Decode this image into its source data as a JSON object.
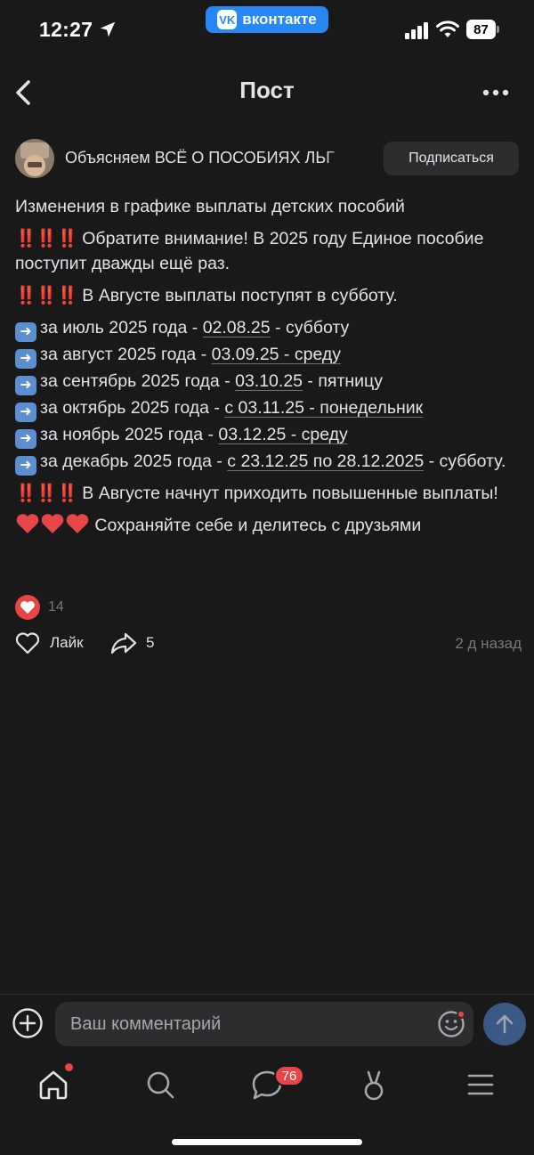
{
  "status_bar": {
    "time": "12:27",
    "app_pill": "вконтакте",
    "battery": "87"
  },
  "header": {
    "title": "Пост"
  },
  "author": {
    "name": "Объясняем ВСЁ О ПОСОБИЯХ ЛЬГ",
    "subscribe_label": "Подписаться"
  },
  "post": {
    "title_line": "Изменения в графике выплаты детских пособий",
    "bangs": "‼️‼️‼️",
    "notice": "Обратите внимание! В 2025 году Единое пособие поступит дважды ещё раз.",
    "august_saturday": "В Августе выплаты поступят в субботу.",
    "schedule": [
      {
        "text": "за июль 2025 года - ",
        "link": "02.08.25",
        "rest": " - субботу"
      },
      {
        "text": "за август 2025 года - ",
        "link": "03.09.25 - среду",
        "rest": ""
      },
      {
        "text": "за сентябрь 2025 года - ",
        "link": "03.10.25",
        "rest": " - пятницу"
      },
      {
        "text": "за октябрь 2025 года - ",
        "link": "с 03.11.25 - понедельник",
        "rest": ""
      },
      {
        "text": "за ноябрь 2025 года - ",
        "link": "03.12.25 - среду",
        "rest": ""
      },
      {
        "text": "за декабрь 2025 года - ",
        "link": "с 23.12.25 по 28.12.2025",
        "rest": " - субботу."
      }
    ],
    "increased": "В Августе начнут приходить повышенные выплаты!",
    "share_call": "Сохраняйте себе и делитесь с друзьями"
  },
  "reactions": {
    "count": "14"
  },
  "actions": {
    "like_label": "Лайк",
    "share_count": "5",
    "time_ago": "2 д назад"
  },
  "comment": {
    "placeholder": "Ваш комментарий"
  },
  "tabbar": {
    "messages_badge": "76"
  },
  "colors": {
    "background": "#19191a",
    "text": "#e1e3e6",
    "secondary": "#76787a",
    "accent": "#2787f5",
    "red": "#e64646"
  },
  "icons": [
    "location-arrow-icon",
    "cellular-signal-icon",
    "wifi-icon",
    "battery-icon",
    "back-chevron-icon",
    "more-dots-icon",
    "arrow-right-emoji-icon",
    "red-heart-emoji-icon",
    "heart-reaction-icon",
    "like-heart-icon",
    "share-arrow-icon",
    "plus-circle-icon",
    "smile-icon",
    "send-arrow-icon",
    "home-icon",
    "search-icon",
    "messages-icon",
    "clips-icon",
    "menu-icon"
  ]
}
